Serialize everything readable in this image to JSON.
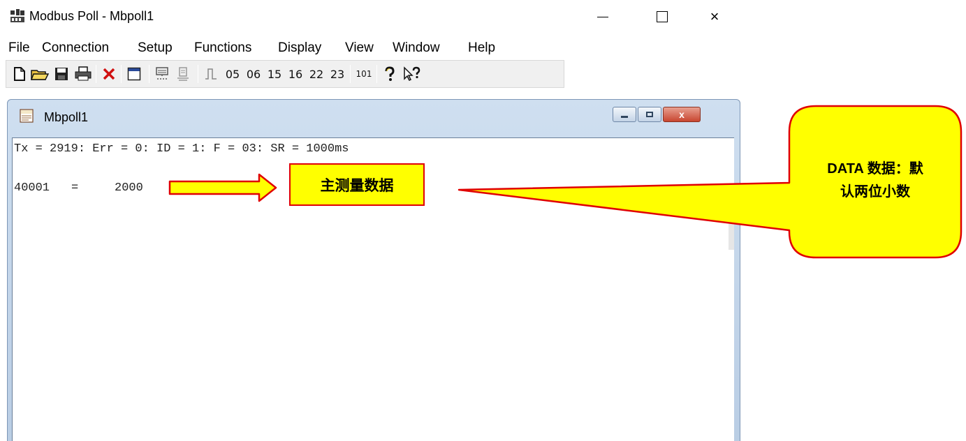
{
  "window": {
    "title": "Modbus Poll - Mbpoll1",
    "minimize_glyph": "",
    "close_glyph": "×"
  },
  "menu": [
    "File",
    "Connection",
    "Setup",
    "Functions",
    "Display",
    "View",
    "Window",
    "Help"
  ],
  "toolbar": {
    "icons": [
      "new-icon",
      "open-icon",
      "save-icon",
      "print-icon",
      "delete-icon",
      "window-icon",
      "connect-icon",
      "disconnect-icon",
      "pulse-icon"
    ],
    "function_codes": [
      "05",
      "06",
      "15",
      "16",
      "22",
      "23"
    ],
    "extra": "101",
    "help_icons": [
      "help-icon",
      "context-help-icon"
    ]
  },
  "child_window": {
    "title": "Mbpoll1",
    "close_glyph": "x",
    "status_line": "Tx = 2919: Err = 0: ID = 1: F = 03: SR = 1000ms",
    "registers": [
      {
        "address": "40001",
        "eq": "=",
        "value": "2000"
      }
    ]
  },
  "annotations": {
    "main_label": "主测量数据",
    "callout_line1": "DATA 数据：默",
    "callout_line2": "认两位小数",
    "colors": {
      "fill": "#ffff00",
      "border": "#e00000"
    }
  }
}
